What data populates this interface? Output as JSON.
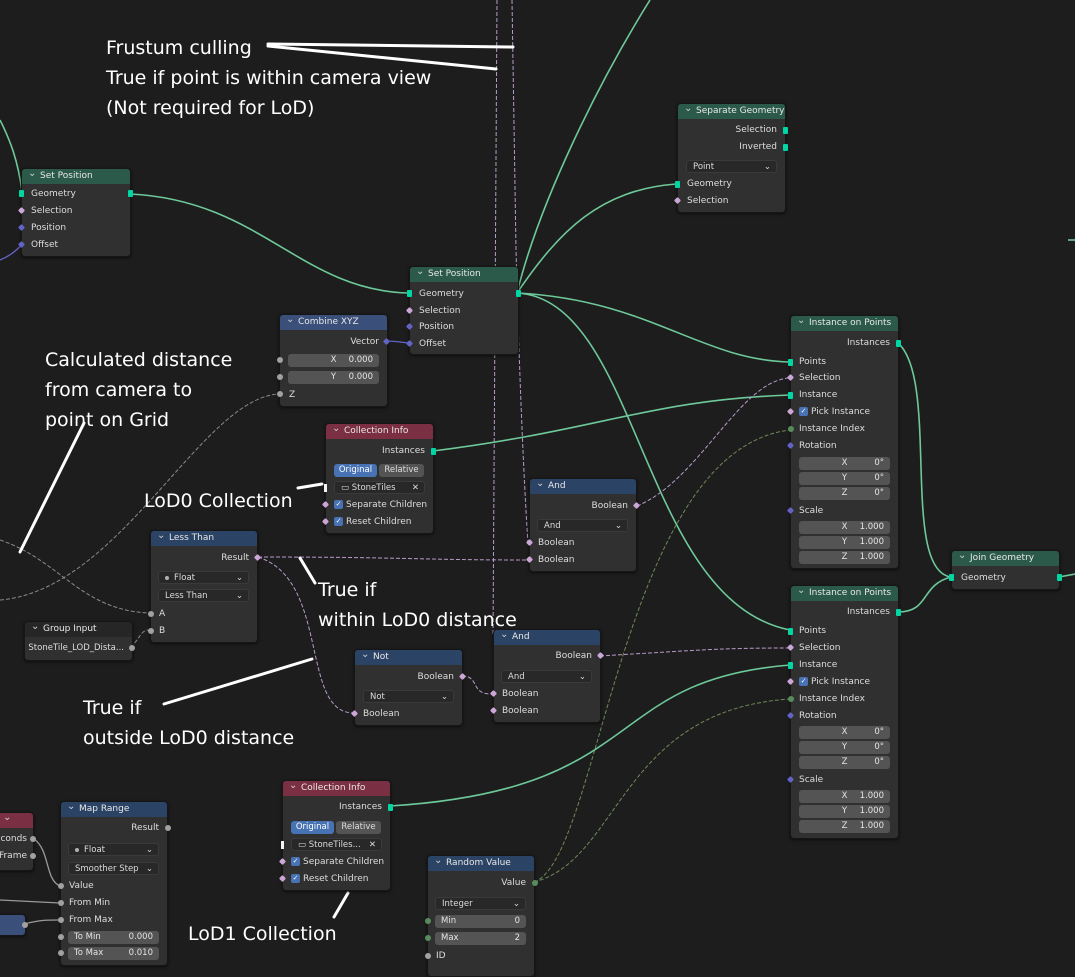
{
  "annotations": {
    "frustum": [
      "Frustum culling",
      "True if point is within camera view",
      "(Not required for LoD)"
    ],
    "distance": [
      "Calculated distance",
      "from camera to",
      "point on Grid"
    ],
    "lod0": "LoD0 Collection",
    "within": [
      "True if",
      "within LoD0 distance"
    ],
    "outside": [
      "True if",
      "outside LoD0 distance"
    ],
    "lod1": "LoD1 Collection"
  },
  "nodes": {
    "set_position_1": {
      "title": "Set Position",
      "geometry": "Geometry",
      "selection": "Selection",
      "position": "Position",
      "offset": "Offset"
    },
    "set_position_2": {
      "title": "Set Position",
      "geometry": "Geometry",
      "selection": "Selection",
      "position": "Position",
      "offset": "Offset"
    },
    "separate_geometry": {
      "title": "Separate Geometry",
      "selection_out": "Selection",
      "inverted": "Inverted",
      "mode": "Point",
      "geometry": "Geometry",
      "selection": "Selection"
    },
    "combine_xyz": {
      "title": "Combine XYZ",
      "vector": "Vector",
      "x_label": "X",
      "x_value": "0.000",
      "y_label": "Y",
      "y_value": "0.000",
      "z": "Z"
    },
    "collection_info_1": {
      "title": "Collection Info",
      "instances": "Instances",
      "original": "Original",
      "relative": "Relative",
      "collection": "StoneTiles",
      "separate_children": "Separate Children",
      "reset_children": "Reset Children"
    },
    "collection_info_2": {
      "title": "Collection Info",
      "instances": "Instances",
      "original": "Original",
      "relative": "Relative",
      "collection": "StoneTiles...",
      "separate_children": "Separate Children",
      "reset_children": "Reset Children"
    },
    "and_1": {
      "title": "And",
      "boolean_out": "Boolean",
      "mode": "And",
      "a": "Boolean",
      "b": "Boolean"
    },
    "and_2": {
      "title": "And",
      "boolean_out": "Boolean",
      "mode": "And",
      "a": "Boolean",
      "b": "Boolean"
    },
    "less_than": {
      "title": "Less Than",
      "result": "Result",
      "type": "Float",
      "op": "Less Than",
      "a": "A",
      "b": "B"
    },
    "group_input": {
      "title": "Group Input",
      "socket": "StoneTile_LOD_Dista..."
    },
    "not": {
      "title": "Not",
      "boolean_out": "Boolean",
      "mode": "Not",
      "boolean_in": "Boolean"
    },
    "instance_on_points_1": {
      "title": "Instance on Points",
      "instances": "Instances",
      "points": "Points",
      "selection": "Selection",
      "instance": "Instance",
      "pick_instance": "Pick Instance",
      "instance_index": "Instance Index",
      "rotation": "Rotation",
      "rx": "0°",
      "ry": "0°",
      "rz": "0°",
      "scale": "Scale",
      "sx": "1.000",
      "sy": "1.000",
      "sz": "1.000"
    },
    "instance_on_points_2": {
      "title": "Instance on Points",
      "instances": "Instances",
      "points": "Points",
      "selection": "Selection",
      "instance": "Instance",
      "pick_instance": "Pick Instance",
      "instance_index": "Instance Index",
      "rotation": "Rotation",
      "rx": "0°",
      "ry": "0°",
      "rz": "0°",
      "scale": "Scale",
      "sx": "1.000",
      "sy": "1.000",
      "sz": "1.000"
    },
    "join_geometry": {
      "title": "Join Geometry",
      "geometry": "Geometry"
    },
    "map_range": {
      "title": "Map Range",
      "result": "Result",
      "type": "Float",
      "interp": "Smoother Step",
      "value": "Value",
      "from_min": "From Min",
      "from_max": "From Max",
      "to_min": "To Min",
      "to_min_v": "0.000",
      "to_max": "To Max",
      "to_max_v": "0.010"
    },
    "random_value": {
      "title": "Random Value",
      "value": "Value",
      "type": "Integer",
      "min": "Min",
      "min_v": "0",
      "max": "Max",
      "max_v": "2",
      "id": "ID"
    },
    "partial_left": {
      "seconds": "conds",
      "frame": "Frame"
    }
  },
  "xyz": {
    "x": "X",
    "y": "Y",
    "z": "Z"
  },
  "colors": {
    "geometry": "#00d6a3",
    "boolean": "#cca6d6",
    "vector": "#6363c7",
    "float": "#a1a1a1",
    "integer": "#598c5c",
    "background": "#1d1d1d"
  }
}
